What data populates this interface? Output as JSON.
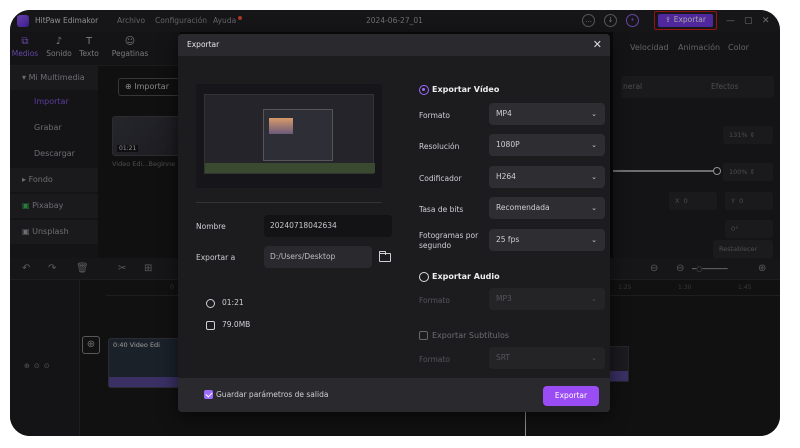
{
  "app": {
    "name": "HitPaw Edimakor",
    "menu": [
      "Archivo",
      "Configuración",
      "Ayuda"
    ],
    "project_title": "2024-06-27_01",
    "export_label": "Exportar"
  },
  "toolbar": {
    "items": [
      {
        "label": "Medios",
        "icon": "media-icon"
      },
      {
        "label": "Sonido",
        "icon": "music-note-icon"
      },
      {
        "label": "Texto",
        "icon": "text-icon"
      },
      {
        "label": "Pegatinas",
        "icon": "sticker-icon"
      }
    ]
  },
  "sidebar": {
    "items": [
      {
        "label": "Mi Multimedia"
      },
      {
        "label": "Importar"
      },
      {
        "label": "Grabar"
      },
      {
        "label": "Descargar"
      },
      {
        "label": "Fondo"
      },
      {
        "label": "Pixabay"
      },
      {
        "label": "Unsplash"
      }
    ]
  },
  "media": {
    "import_label": "Importar",
    "thumb_duration": "01:21",
    "thumb_caption": "Video Edi...Beginne"
  },
  "rightpanel": {
    "tabs": [
      "Velocidad",
      "Animación",
      "Color"
    ],
    "subtabs": [
      "neral",
      "Efectos"
    ],
    "scale_value": "131%",
    "opacity_value": "100%",
    "x_label": "X",
    "x_value": "0",
    "y_label": "Y",
    "y_value": "0",
    "rotation_value": "0°",
    "reset_label": "Restablecer"
  },
  "timeline": {
    "ruler": [
      "0",
      "1:25",
      "1:30",
      "1:45"
    ],
    "clip_label": "0:40 Video Edi"
  },
  "dialog": {
    "title": "Exportar",
    "close": "✕",
    "name_label": "Nombre",
    "name_value": "20240718042634",
    "export_to_label": "Exportar a",
    "export_to_value": "D:/Users/Desktop",
    "duration": "01:21",
    "size": "79.0MB",
    "video_section": "Exportar Vídeo",
    "format_label": "Formato",
    "format_value": "MP4",
    "resolution_label": "Resolución",
    "resolution_value": "1080P",
    "encoder_label": "Codificador",
    "encoder_value": "H264",
    "bitrate_label": "Tasa de bits",
    "bitrate_value": "Recomendada",
    "fps_label": "Fotogramas por segundo",
    "fps_value": "25  fps",
    "audio_section": "Exportar Audio",
    "audio_format_label": "Formato",
    "audio_format_value": "MP3",
    "subtitles_section": "Exportar Subtítulos",
    "subtitle_format_label": "Formato",
    "subtitle_format_value": "SRT",
    "save_params_label": "Guardar parámetros de salida",
    "export_button": "Exportar"
  },
  "colors": {
    "accent": "#9b6cff",
    "export_button": "#9b4df5",
    "highlight_border": "#e02020"
  }
}
